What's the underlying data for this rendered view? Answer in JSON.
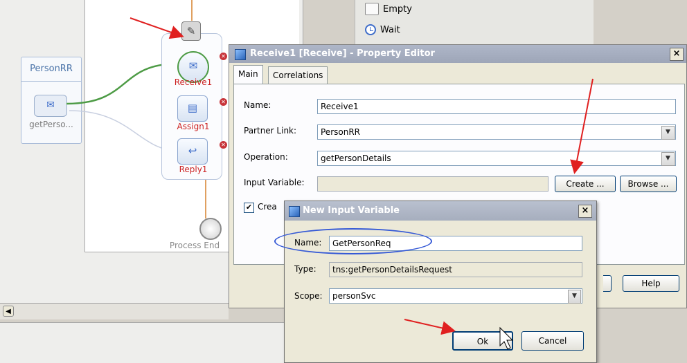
{
  "palette": {
    "items": [
      "Empty",
      "Wait"
    ]
  },
  "partner_link": {
    "name": "PersonRR",
    "operation": "getPerso..."
  },
  "process": {
    "nodes": [
      "Receive1",
      "Assign1",
      "Reply1"
    ],
    "end_label": "Process End"
  },
  "property_editor": {
    "title": "Receive1 [Receive] - Property Editor",
    "tabs": [
      "Main",
      "Correlations"
    ],
    "fields": {
      "name_label": "Name:",
      "name_value": "Receive1",
      "partner_link_label": "Partner Link:",
      "partner_link_value": "PersonRR",
      "operation_label": "Operation:",
      "operation_value": "getPersonDetails",
      "input_variable_label": "Input Variable:",
      "input_variable_value": ""
    },
    "create_button": "Create ...",
    "browse_button": "Browse ...",
    "checkbox_label": "Crea",
    "help_button": "Help",
    "close_glyph": "×"
  },
  "new_input_variable": {
    "title": "New Input Variable",
    "name_label": "Name:",
    "name_value": "GetPersonReq",
    "type_label": "Type:",
    "type_value": "tns:getPersonDetailsRequest",
    "scope_label": "Scope:",
    "scope_value": "personSvc",
    "ok_button": "Ok",
    "cancel_button": "Cancel",
    "close_glyph": "×"
  },
  "colors": {
    "annotation_arrow": "#e02020",
    "highlight": "#3559d6",
    "flow_line": "#4d9b45"
  }
}
